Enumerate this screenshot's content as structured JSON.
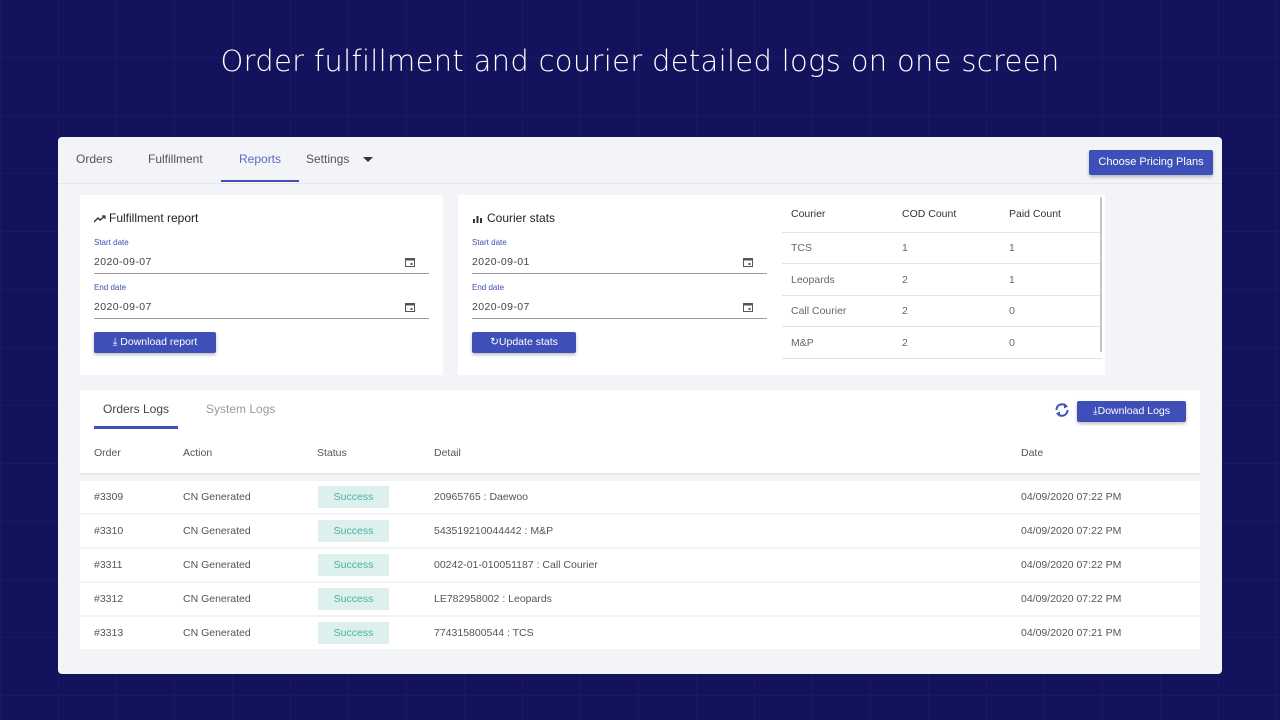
{
  "headline": "Order fulfillment and courier detailed logs on one screen",
  "nav": {
    "tabs": [
      {
        "label": "Orders"
      },
      {
        "label": "Fulfillment"
      },
      {
        "label": "Reports",
        "active": true
      },
      {
        "label": "Settings"
      }
    ],
    "pricing_button": "Choose Pricing Plans"
  },
  "fulfillment_report": {
    "title": "Fulfillment report",
    "icon": "trending-up-icon",
    "start_label": "Start date",
    "start_value": "2020-09-07",
    "end_label": "End date",
    "end_value": "2020-09-07",
    "button": "Download report"
  },
  "courier_stats": {
    "title": "Courier stats",
    "icon": "bar-chart-icon",
    "start_label": "Start date",
    "start_value": "2020-09-01",
    "end_label": "End date",
    "end_value": "2020-09-07",
    "button": "Update stats"
  },
  "courier_table": {
    "headers": [
      "Courier",
      "COD Count",
      "Paid Count"
    ],
    "rows": [
      [
        "TCS",
        "1",
        "1"
      ],
      [
        "Leopards",
        "2",
        "1"
      ],
      [
        "Call Courier",
        "2",
        "0"
      ],
      [
        "M&P",
        "2",
        "0"
      ]
    ]
  },
  "logs": {
    "tabs": [
      "Orders Logs",
      "System Logs"
    ],
    "download_button": "Download Logs",
    "headers": [
      "Order",
      "Action",
      "Status",
      "Detail",
      "Date"
    ],
    "rows": [
      {
        "order": "#3309",
        "action": "CN Generated",
        "status": "Success",
        "detail": "20965765 : Daewoo",
        "date": "04/09/2020 07:22 PM"
      },
      {
        "order": "#3310",
        "action": "CN Generated",
        "status": "Success",
        "detail": "543519210044442 : M&P",
        "date": "04/09/2020 07:22 PM"
      },
      {
        "order": "#3311",
        "action": "CN Generated",
        "status": "Success",
        "detail": "00242-01-010051187 : Call Courier",
        "date": "04/09/2020 07:22 PM"
      },
      {
        "order": "#3312",
        "action": "CN Generated",
        "status": "Success",
        "detail": "LE782958002 : Leopards",
        "date": "04/09/2020 07:22 PM"
      },
      {
        "order": "#3313",
        "action": "CN Generated",
        "status": "Success",
        "detail": "774315800544 : TCS",
        "date": "04/09/2020 07:21 PM"
      }
    ]
  },
  "colors": {
    "background": "#13125c",
    "accent": "#3f51b5",
    "success_bg": "#ddf0ee",
    "success_text": "#45b39d"
  }
}
